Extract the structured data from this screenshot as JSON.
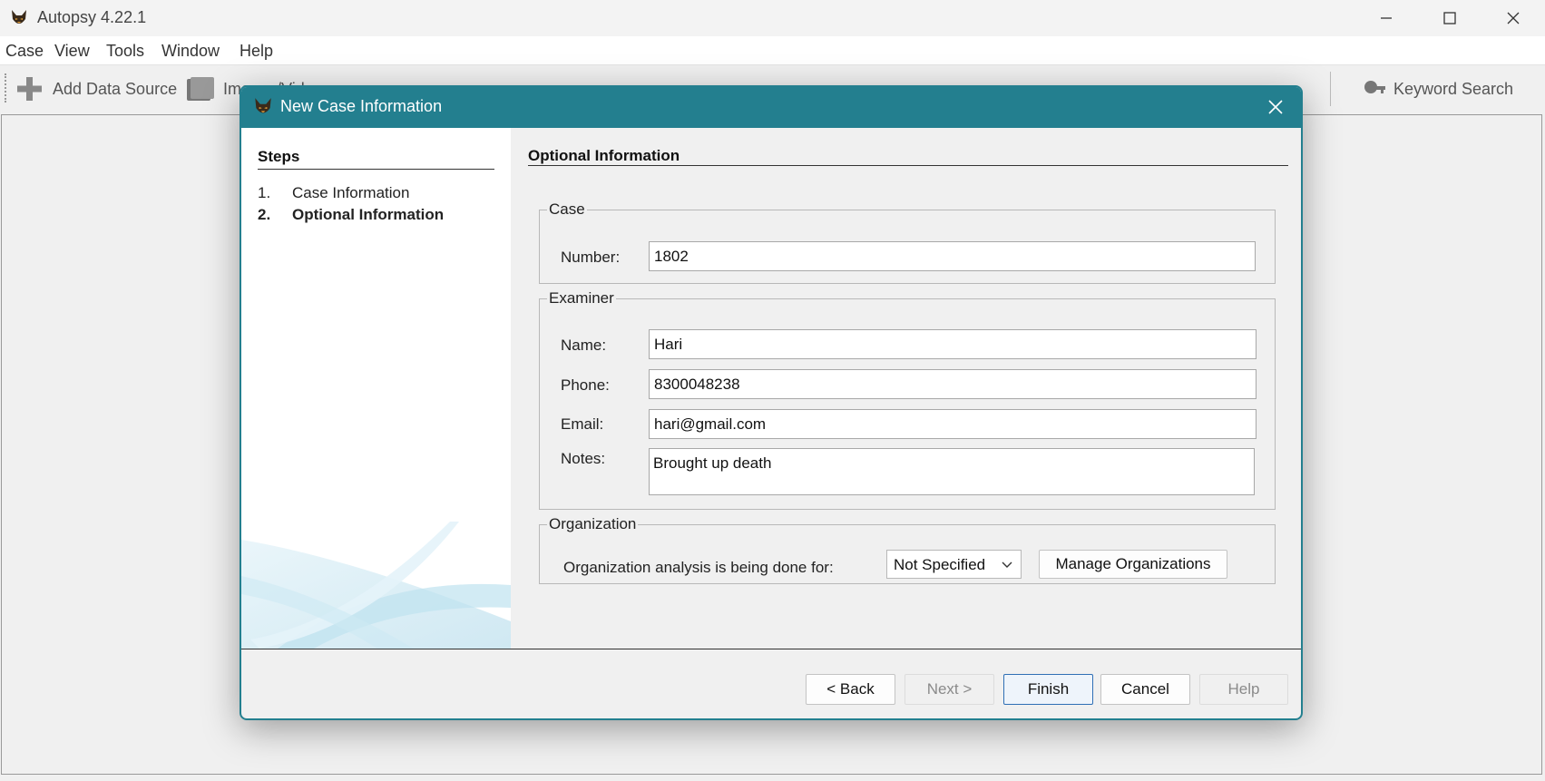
{
  "window": {
    "title": "Autopsy 4.22.1",
    "controls": {
      "minimize": "—",
      "maximize": "☐",
      "close": "✕"
    }
  },
  "menu": {
    "items": [
      "Case",
      "View",
      "Tools",
      "Window",
      "Help"
    ]
  },
  "toolbar": {
    "add_data_source": "Add Data Source",
    "images_videos": "Images/Videos",
    "keyword_search": "Keyword Search"
  },
  "dialog": {
    "title": "New Case Information",
    "close": "✕",
    "steps_heading": "Steps",
    "steps": [
      {
        "num": "1.",
        "label": "Case Information"
      },
      {
        "num": "2.",
        "label": "Optional Information"
      }
    ],
    "content_heading": "Optional Information",
    "case_group": {
      "legend": "Case",
      "number_label": "Number:",
      "number_value": "1802"
    },
    "examiner_group": {
      "legend": "Examiner",
      "name_label": "Name:",
      "name_value": "Hari",
      "phone_label": "Phone:",
      "phone_value": "8300048238",
      "email_label": "Email:",
      "email_value": "hari@gmail.com",
      "notes_label": "Notes:",
      "notes_value": "Brought up death"
    },
    "organization_group": {
      "legend": "Organization",
      "analysis_label": "Organization analysis is being done for:",
      "selected": "Not Specified",
      "manage_button": "Manage Organizations"
    },
    "buttons": {
      "back": "< Back",
      "next": "Next >",
      "finish": "Finish",
      "cancel": "Cancel",
      "help": "Help"
    }
  },
  "colors": {
    "dialog_titlebar": "#237f8f",
    "primary_button_border": "#2f6fb5"
  }
}
